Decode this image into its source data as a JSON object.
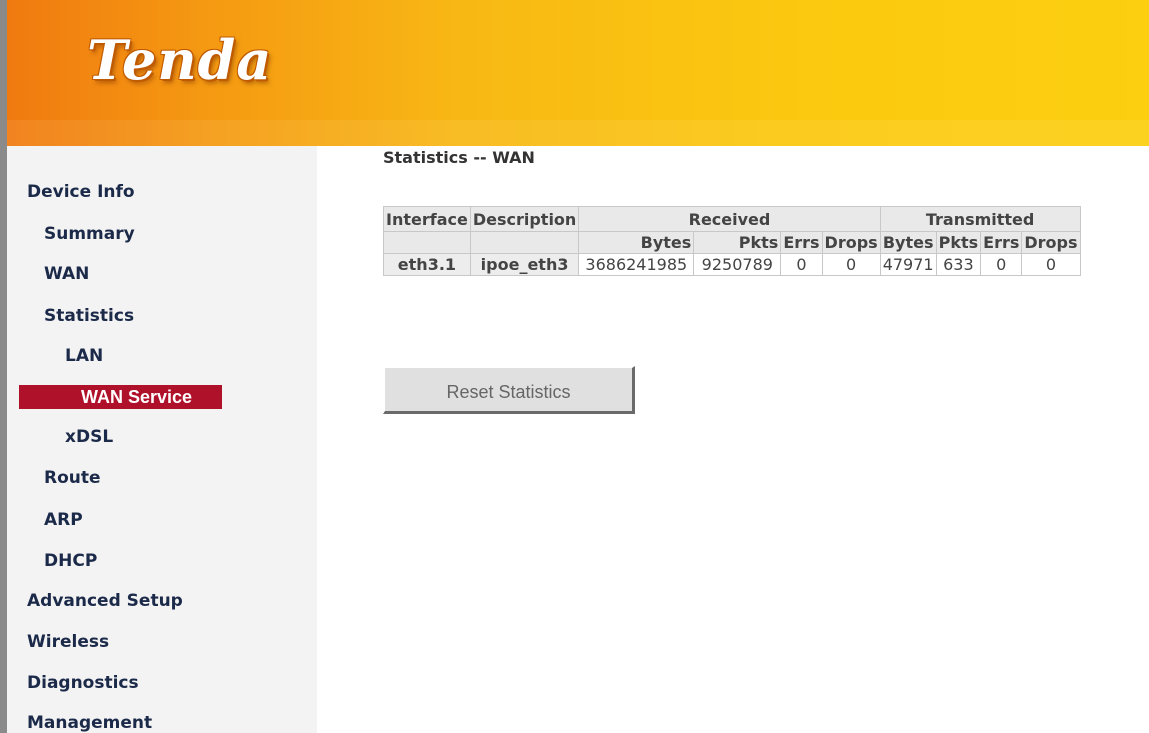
{
  "header": {
    "logo": "Tenda"
  },
  "sidebar": {
    "items": [
      {
        "label": "Device Info"
      },
      {
        "label": "Summary"
      },
      {
        "label": "WAN"
      },
      {
        "label": "Statistics"
      },
      {
        "label": "LAN"
      },
      {
        "label": "WAN Service",
        "active": true
      },
      {
        "label": "xDSL"
      },
      {
        "label": "Route"
      },
      {
        "label": "ARP"
      },
      {
        "label": "DHCP"
      },
      {
        "label": "Advanced Setup"
      },
      {
        "label": "Wireless"
      },
      {
        "label": "Diagnostics"
      },
      {
        "label": "Management"
      }
    ]
  },
  "main": {
    "title": "Statistics -- WAN",
    "table": {
      "headers": {
        "interface": "Interface",
        "description": "Description",
        "received": "Received",
        "transmitted": "Transmitted",
        "sub": [
          "Bytes",
          "Pkts",
          "Errs",
          "Drops",
          "Bytes",
          "Pkts",
          "Errs",
          "Drops"
        ]
      },
      "rows": [
        {
          "interface": "eth3.1",
          "description": "ipoe_eth3",
          "rx": [
            "3686241985",
            "9250789",
            "0",
            "0"
          ],
          "tx": [
            "47971",
            "633",
            "0",
            "0"
          ]
        }
      ]
    },
    "reset_button": "Reset Statistics"
  },
  "colors": {
    "accent": "#b0112a",
    "header_start": "#f07a10",
    "header_end": "#fccf10"
  }
}
